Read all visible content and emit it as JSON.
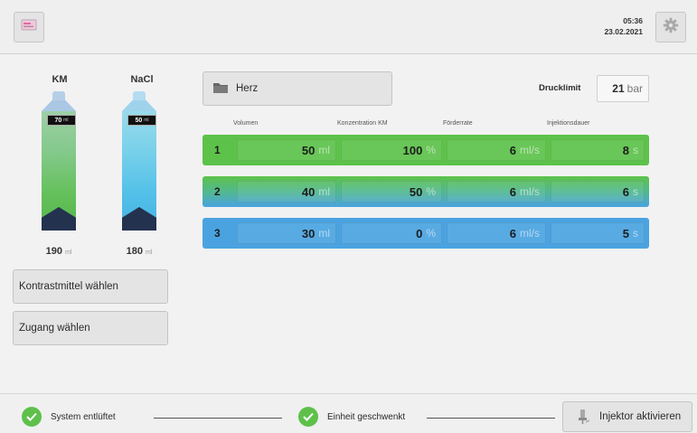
{
  "header": {
    "time": "05:36",
    "date": "23.02.2021"
  },
  "bottles": {
    "km": {
      "label": "KM",
      "badge_value": "70",
      "badge_unit": "ml",
      "volume": "190",
      "unit": "ml"
    },
    "nacl": {
      "label": "NaCl",
      "badge_value": "50",
      "badge_unit": "ml",
      "volume": "180",
      "unit": "ml"
    }
  },
  "side_buttons": {
    "contrast": "Kontrastmittel wählen",
    "access": "Zugang wählen"
  },
  "protocol": {
    "name": "Herz"
  },
  "pressure": {
    "label": "Drucklimit",
    "value": "21",
    "unit": "bar"
  },
  "columns": {
    "volume": "Volumen",
    "concentration": "Konzentration KM",
    "flow": "Förderrate",
    "duration": "Injektionsdauer"
  },
  "phases": [
    {
      "index": "1",
      "volume": "50",
      "volume_unit": "ml",
      "conc": "100",
      "conc_unit": "%",
      "flow": "6",
      "flow_unit": "ml/s",
      "duration": "8",
      "duration_unit": "s"
    },
    {
      "index": "2",
      "volume": "40",
      "volume_unit": "ml",
      "conc": "50",
      "conc_unit": "%",
      "flow": "6",
      "flow_unit": "ml/s",
      "duration": "6",
      "duration_unit": "s"
    },
    {
      "index": "3",
      "volume": "30",
      "volume_unit": "ml",
      "conc": "0",
      "conc_unit": "%",
      "flow": "6",
      "flow_unit": "ml/s",
      "duration": "5",
      "duration_unit": "s"
    }
  ],
  "footer": {
    "status1": "System entlüftet",
    "status2": "Einheit geschwenkt",
    "activate": "Injektor aktivieren"
  },
  "colors": {
    "green": "#5dc24a",
    "blue": "#4aa3e0",
    "check": "#5ec04b"
  },
  "icons": {
    "menu": "screen-menu-icon",
    "settings": "gear-icon",
    "folder": "folder-icon",
    "check": "check-icon",
    "injector": "injector-icon"
  }
}
